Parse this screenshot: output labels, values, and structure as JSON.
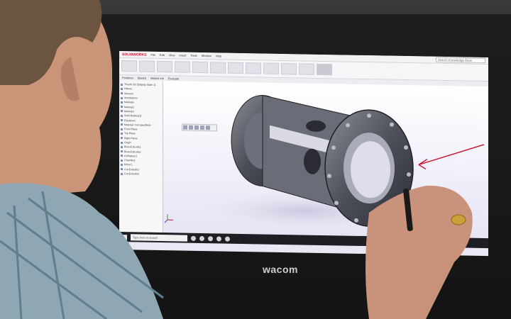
{
  "app": {
    "brand": "SOLIDWORKS",
    "menu": [
      "File",
      "Edit",
      "View",
      "Insert",
      "Tools",
      "Window",
      "Help"
    ],
    "search_placeholder": "Search Knowledge Base"
  },
  "tabs": [
    "Features",
    "Sketch",
    "Sketch Ink",
    "Evaluate"
  ],
  "tree": [
    "Thumb 3D (Display State 1)",
    "History",
    "Sensors",
    "Annotations",
    "Markups",
    "Markup1",
    "Markup2",
    "Solid Bodies(1)",
    "Equations",
    "Material <not specified>",
    "Front Plane",
    "Top Plane",
    "Right Plane",
    "Origin",
    "Boss-Extrude1",
    "Boss-Extrude2",
    "CirPattern1",
    "Chamfer1",
    "Mirror1",
    "Cut-Extrude1",
    "Cut-Extrude2"
  ],
  "taskbar": {
    "search_placeholder": "Type here to search"
  },
  "tablet": {
    "logo": "wacom"
  },
  "colors": {
    "annotation": "#c8102e",
    "part": "#5a5c66"
  }
}
